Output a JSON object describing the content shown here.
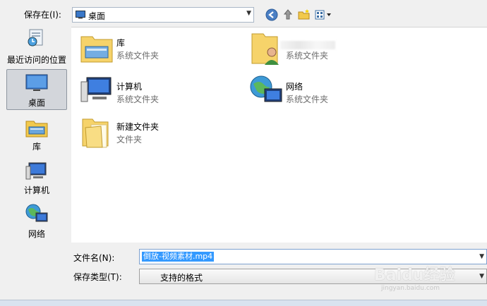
{
  "toolbar": {
    "save_in_label": "保存在(I):",
    "location": "桌面",
    "back_icon": "back-arrow-icon",
    "up_icon": "up-folder-icon",
    "new_folder_icon": "new-folder-icon",
    "view_menu_icon": "view-menu-icon"
  },
  "places": [
    {
      "label": "最近访问的位置",
      "icon": "recent-places-icon"
    },
    {
      "label": "桌面",
      "icon": "desktop-icon"
    },
    {
      "label": "库",
      "icon": "libraries-icon"
    },
    {
      "label": "计算机",
      "icon": "computer-icon"
    },
    {
      "label": "网络",
      "icon": "network-icon"
    }
  ],
  "files": [
    {
      "name": "库",
      "type": "系统文件夹",
      "icon": "libraries-folder-icon"
    },
    {
      "name": "",
      "type": "系统文件夹",
      "icon": "user-folder-icon"
    },
    {
      "name": "计算机",
      "type": "系统文件夹",
      "icon": "computer-icon"
    },
    {
      "name": "网络",
      "type": "系统文件夹",
      "icon": "network-icon"
    },
    {
      "name": "新建文件夹",
      "type": "文件夹",
      "icon": "folder-icon"
    }
  ],
  "form": {
    "filename_label": "文件名(N):",
    "filename_value": "倒放-视频素材.mp4",
    "filetype_label": "保存类型(T):",
    "filetype_value": "支持的格式"
  },
  "watermark": {
    "brand": "Baidu经验",
    "url": "jingyan.baidu.com"
  },
  "colors": {
    "selection": "#3399ff",
    "selected_place": "#d3d6db"
  }
}
